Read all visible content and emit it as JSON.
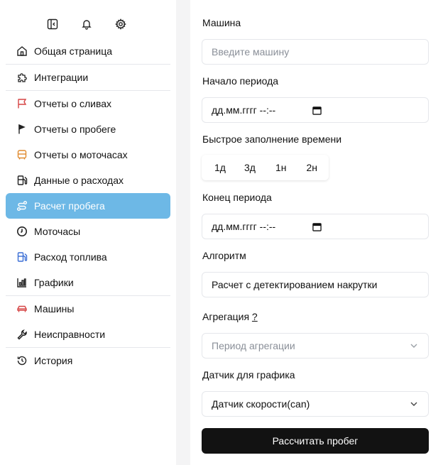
{
  "toolbar": {
    "icons": [
      "sidebar-collapse-icon",
      "bell-icon",
      "gear-icon"
    ]
  },
  "sidebar": {
    "items": [
      {
        "label": "Общая страница",
        "icon": "home-icon",
        "icon_color": "#222222"
      },
      {
        "label": "Интеграции",
        "icon": "puzzle-icon",
        "icon_color": "#222222"
      },
      {
        "label": "Отчеты о сливах",
        "icon": "flag-icon",
        "icon_color": "#d64545"
      },
      {
        "label": "Отчеты о пробеге",
        "icon": "pennant-icon",
        "icon_color": "#222222"
      },
      {
        "label": "Отчеты о моточасах",
        "icon": "bus-icon",
        "icon_color": "#e08a2e"
      },
      {
        "label": "Данные о расходах",
        "icon": "fuel-pump-icon",
        "icon_color": "#222222"
      },
      {
        "label": "Расчет пробега",
        "icon": "route-icon",
        "icon_color": "#ffffff",
        "active": true
      },
      {
        "label": "Моточасы",
        "icon": "clock-icon",
        "icon_color": "#222222"
      },
      {
        "label": "Расход топлива",
        "icon": "fuel-icon",
        "icon_color": "#3b6fd6"
      },
      {
        "label": "Графики",
        "icon": "bar-chart-icon",
        "icon_color": "#222222"
      },
      {
        "label": "Машины",
        "icon": "car-icon",
        "icon_color": "#d64545"
      },
      {
        "label": "Неисправности",
        "icon": "wrench-icon",
        "icon_color": "#222222"
      },
      {
        "label": "История",
        "icon": "history-icon",
        "icon_color": "#222222"
      }
    ]
  },
  "form": {
    "car_label": "Машина",
    "car_placeholder": "Введите машину",
    "start_label": "Начало периода",
    "start_value": "дд.мм.гггг --:--",
    "quick_label": "Быстрое заполнение времени",
    "quick_options": [
      "1д",
      "3д",
      "1н",
      "2н"
    ],
    "end_label": "Конец периода",
    "end_value": "дд.мм.гггг --:--",
    "algo_label": "Алгоритм",
    "algo_value": "Расчет с детектированием накрутки",
    "agg_label": "Агрегация",
    "agg_help": "?",
    "agg_placeholder": "Период агрегации",
    "sensor_label": "Датчик для графика",
    "sensor_value": "Датчик скорости(can)",
    "submit_label": "Рассчитать пробег"
  },
  "colors": {
    "accent": "#6db8e6",
    "button_dark": "#121212"
  }
}
